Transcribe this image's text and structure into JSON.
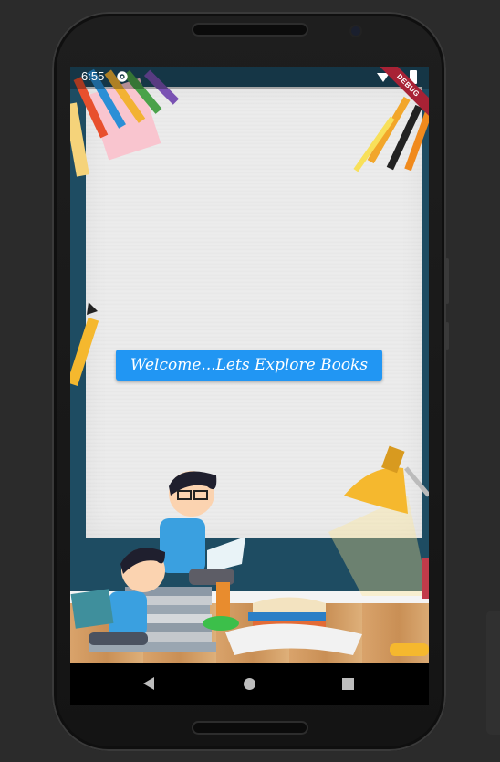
{
  "status_bar": {
    "time": "6:55",
    "debug_label": "DEBUG"
  },
  "main": {
    "welcome_button_label": "Welcome...Lets Explore Books"
  },
  "icons": [
    "gear-icon",
    "wifi-icon",
    "battery-icon",
    "back-icon",
    "home-icon",
    "recents-icon"
  ],
  "colors": {
    "button": "#2196f3",
    "debug_banner": "#a82235",
    "wall": "#1e4c62"
  }
}
